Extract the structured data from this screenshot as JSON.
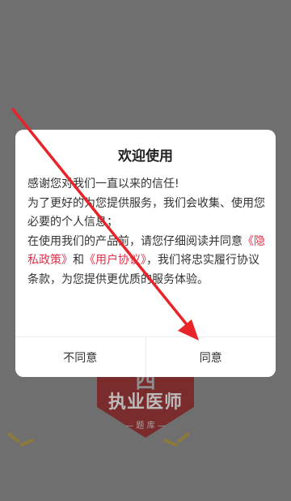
{
  "splash": {
    "logo_seal": "中西",
    "logo_title": "执业医师",
    "logo_subtitle": "— 题 库 —"
  },
  "dialog": {
    "title": "欢迎使用",
    "line1": "感谢您对我们一直以来的信任!",
    "line2": "为了更好的为您提供服务，我们会收集、使用您必要的个人信息；",
    "line3_prefix": "在使用我们的产品前，请您仔细阅读并同意",
    "privacy_link": "《隐私政策》",
    "conjunction": "和",
    "agreement_link": "《用户协议》",
    "line3_suffix": "，我们将忠实履行协议条款，为您提供更优质的服务体验。",
    "disagree_label": "不同意",
    "agree_label": "同意"
  },
  "colors": {
    "overlay": "#6f6f6f",
    "link": "#e0324b",
    "annotation_arrow": "#e8232a"
  }
}
